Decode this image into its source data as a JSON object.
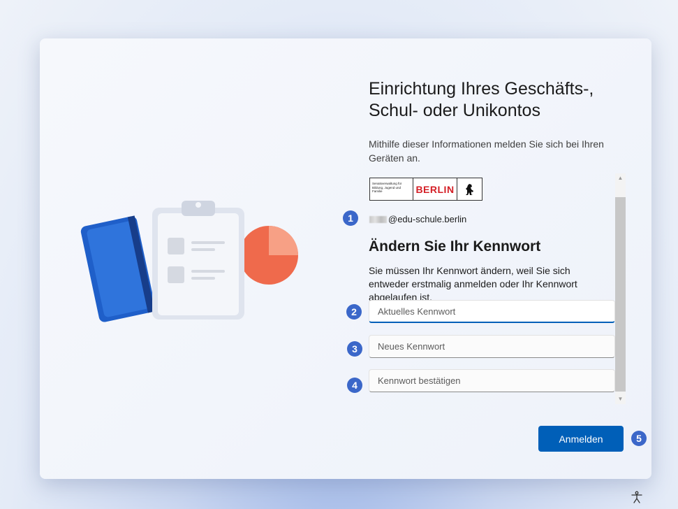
{
  "header": {
    "title": "Einrichtung Ihres Geschäfts-, Schul- oder Unikontos",
    "subtitle": "Mithilfe dieser Informationen melden Sie sich bei Ihren Geräten an."
  },
  "logo": {
    "org_text": "Senatsverwaltung für Bildung, Jugend und Familie",
    "city": "BERLIN",
    "emblem_icon": "berlin-bear-icon"
  },
  "account": {
    "email_suffix": "@edu-schule.berlin"
  },
  "change_password": {
    "heading": "Ändern Sie Ihr Kennwort",
    "description": "Sie müssen Ihr Kennwort ändern, weil Sie sich entweder erstmalig anmelden oder Ihr Kennwort abgelaufen ist.",
    "current_placeholder": "Aktuelles Kennwort",
    "new_placeholder": "Neues Kennwort",
    "confirm_placeholder": "Kennwort bestätigen"
  },
  "actions": {
    "sign_in_label": "Anmelden"
  },
  "annotations": [
    "1",
    "2",
    "3",
    "4",
    "5"
  ],
  "colors": {
    "accent": "#005fb8",
    "badge": "#3b67c9",
    "berlin_red": "#d41f26"
  },
  "icons": {
    "accessibility": "accessibility-icon"
  }
}
